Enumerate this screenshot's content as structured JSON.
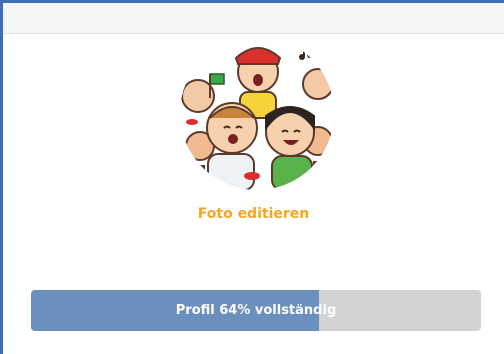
{
  "profile": {
    "avatar_icon": "kids-singing-illustration",
    "edit_photo_label": "Foto editieren"
  },
  "progress": {
    "label": "Profil 64% vollständig",
    "fraction": 0.64,
    "fill_color": "#6c90bd",
    "track_color": "#d2d2d2"
  },
  "colors": {
    "accent": "#f5a623",
    "frame_border": "#3f6fb3"
  }
}
